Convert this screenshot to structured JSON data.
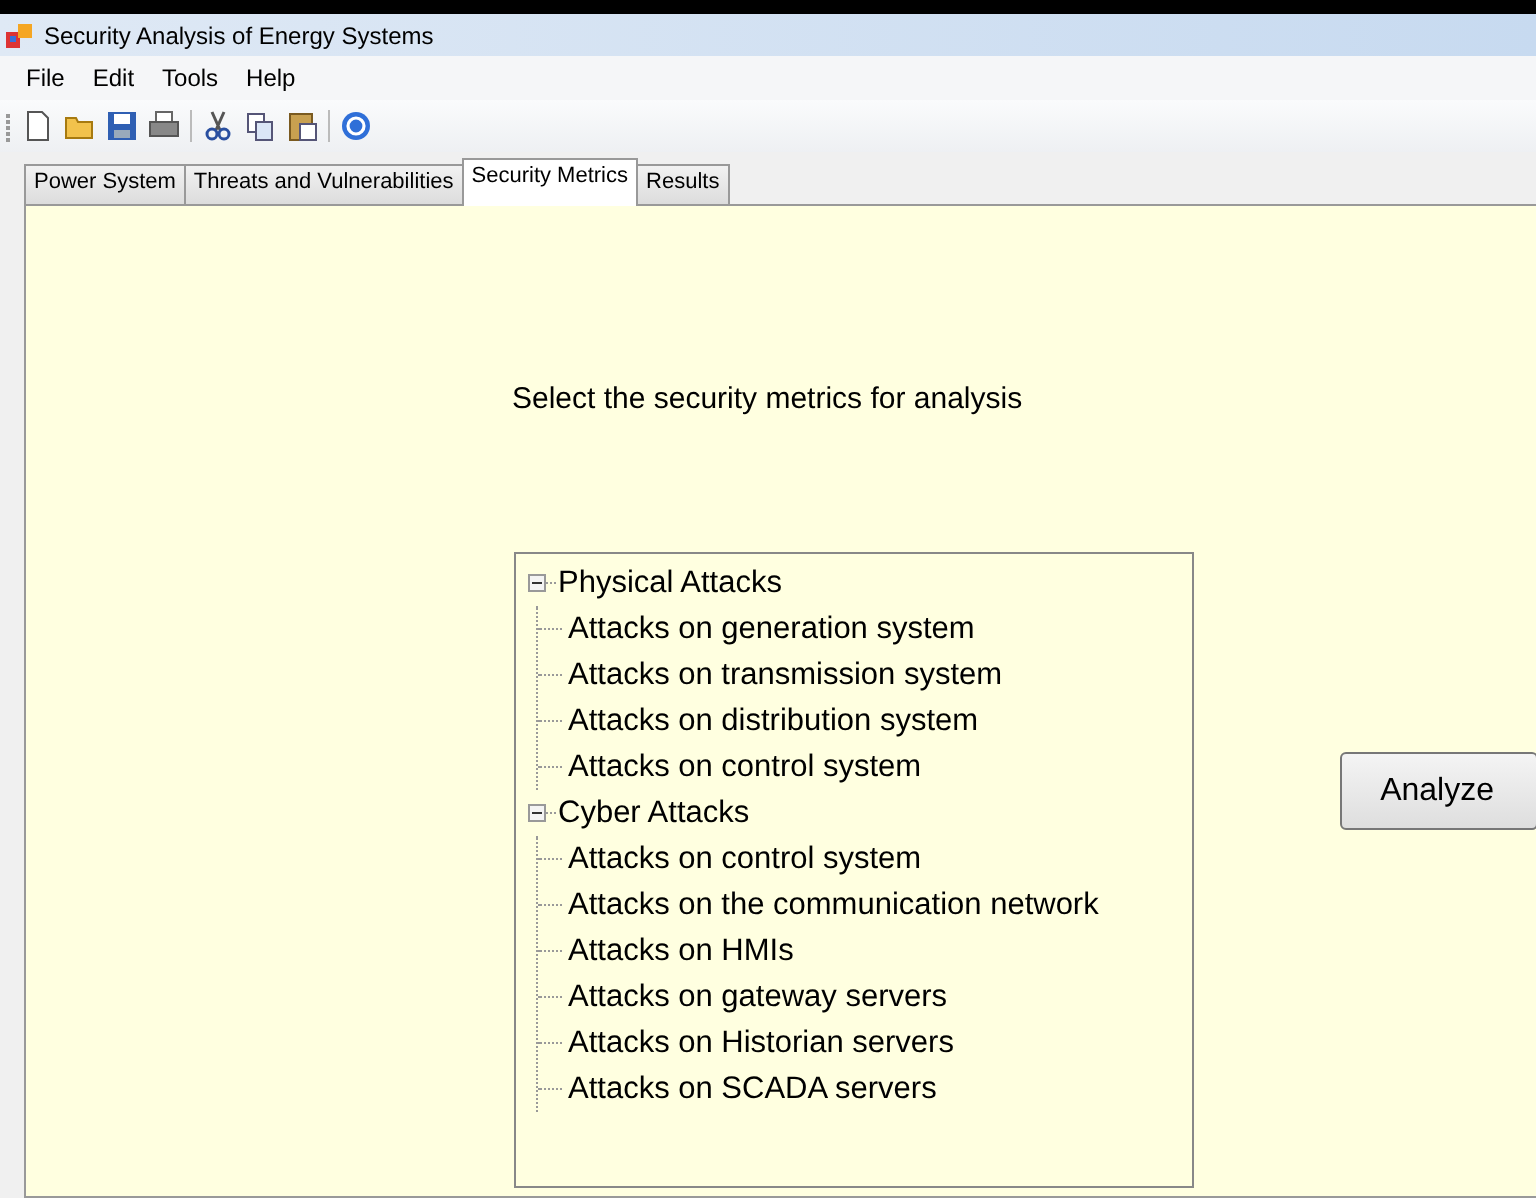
{
  "window": {
    "title": "Security Analysis of Energy Systems"
  },
  "menu": [
    "File",
    "Edit",
    "Tools",
    "Help"
  ],
  "toolbar": [
    {
      "kind": "new"
    },
    {
      "kind": "open"
    },
    {
      "kind": "save"
    },
    {
      "kind": "print"
    },
    {
      "kind": "sep"
    },
    {
      "kind": "cut"
    },
    {
      "kind": "copy"
    },
    {
      "kind": "paste"
    },
    {
      "kind": "sep"
    },
    {
      "kind": "help"
    }
  ],
  "tabs": [
    {
      "label": "Power System",
      "selected": false
    },
    {
      "label": "Threats and Vulnerabilities",
      "selected": false
    },
    {
      "label": "Security Metrics",
      "selected": true
    },
    {
      "label": "Results",
      "selected": false
    }
  ],
  "prompt": "Select the security metrics for analysis",
  "tree": [
    {
      "label": "Physical Attacks",
      "expanded": true,
      "children": [
        {
          "label": "Attacks on generation system"
        },
        {
          "label": "Attacks on transmission system"
        },
        {
          "label": "Attacks on distribution system"
        },
        {
          "label": "Attacks on control system"
        }
      ]
    },
    {
      "label": "Cyber Attacks",
      "expanded": true,
      "children": [
        {
          "label": "Attacks on control system"
        },
        {
          "label": "Attacks on the communication network"
        },
        {
          "label": "Attacks on HMIs"
        },
        {
          "label": "Attacks on gateway servers"
        },
        {
          "label": "Attacks on Historian servers"
        },
        {
          "label": "Attacks on SCADA servers"
        }
      ]
    }
  ],
  "analyze_button": "Analyze"
}
